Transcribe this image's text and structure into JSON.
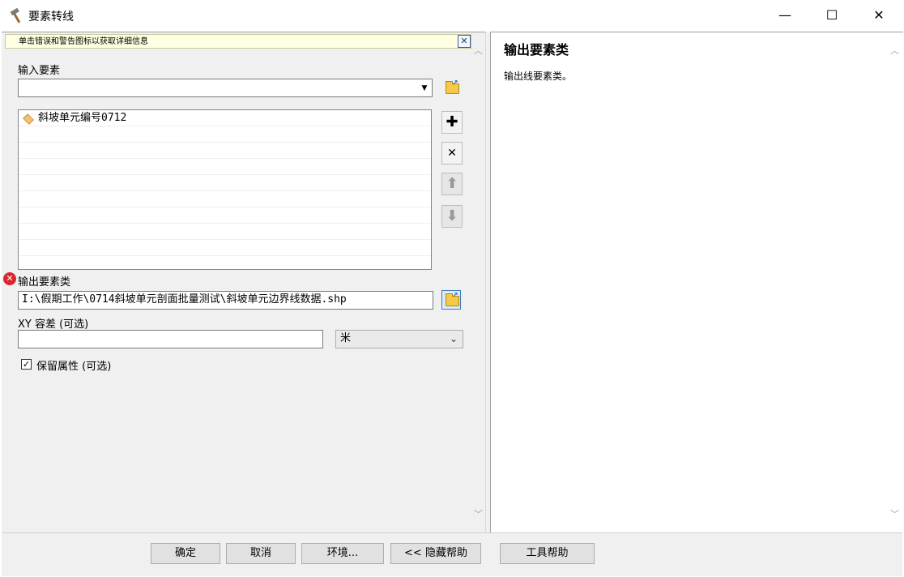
{
  "window": {
    "title": "要素转线",
    "minimize": "—",
    "maximize": "☐",
    "close": "✕"
  },
  "banner": {
    "text": "单击错误和警告图标以获取详细信息",
    "close": "✕"
  },
  "input_features": {
    "label": "输入要素",
    "value": "",
    "items": [
      "斜坡单元编号0712",
      "",
      "",
      "",
      "",
      "",
      "",
      "",
      "",
      ""
    ]
  },
  "side_buttons": {
    "add": "✚",
    "remove": "✕",
    "up": "⬆",
    "down": "⬇"
  },
  "output": {
    "label": "输出要素类",
    "value": "I:\\假期工作\\0714斜坡单元剖面批量测试\\斜坡单元边界线数据.shp"
  },
  "xy_tolerance": {
    "label": "XY 容差 (可选)",
    "value": "",
    "unit": "米"
  },
  "preserve_attributes": {
    "label": "保留属性 (可选)",
    "checked": true,
    "check_mark": "✓"
  },
  "help": {
    "title": "输出要素类",
    "body": "输出线要素类。"
  },
  "buttons": {
    "ok": "确定",
    "cancel": "取消",
    "environments": "环境...",
    "hide_help": "<< 隐藏帮助",
    "tool_help": "工具帮助"
  },
  "scroll": {
    "up": "︿",
    "down": "﹀"
  }
}
